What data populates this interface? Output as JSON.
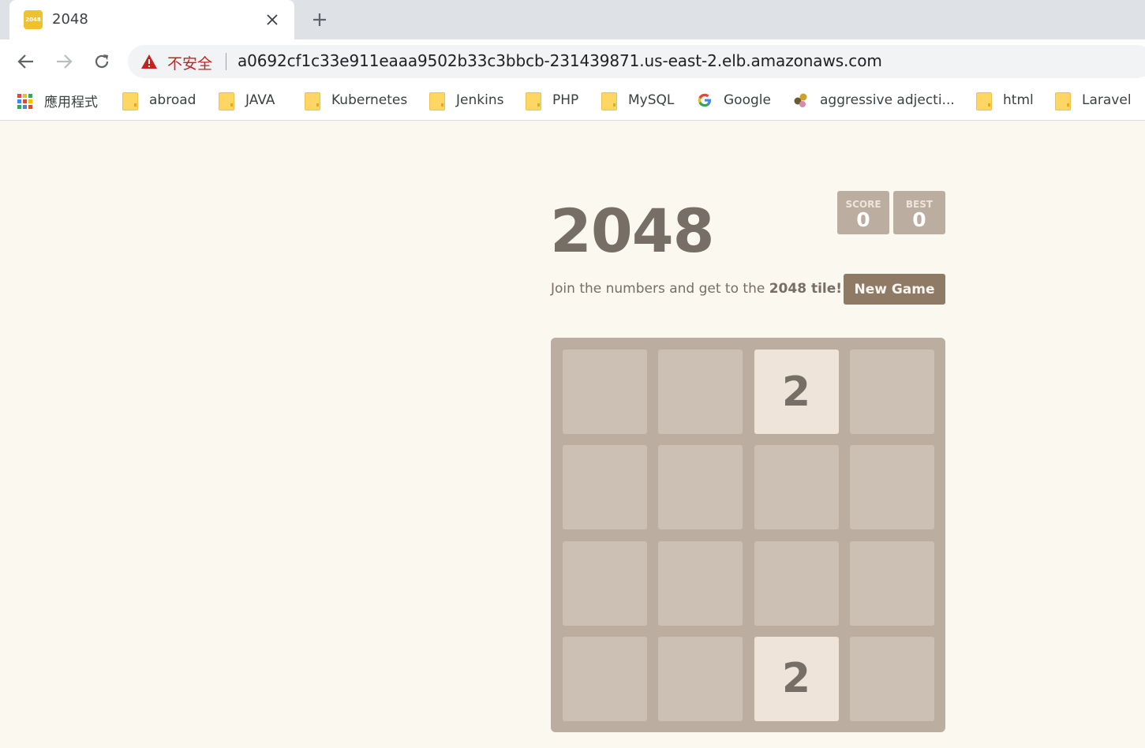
{
  "browser": {
    "tab": {
      "title": "2048",
      "favicon_text": "2048",
      "favicon_color": "#edc22e"
    },
    "new_tab_icon": "plus-icon",
    "close_icon": "close-icon",
    "nav": {
      "back_icon": "back-arrow-icon",
      "forward_icon": "forward-arrow-icon",
      "reload_icon": "reload-icon"
    },
    "omnibox": {
      "security_label": "不安全",
      "security_color": "#c5221f",
      "url": "a0692cf1c33e911eaaa9502b33c3bbcb-231439871.us-east-2.elb.amazonaws.com"
    },
    "bookmarks": [
      {
        "label": "應用程式",
        "icon": "apps-grid-icon"
      },
      {
        "label": "abroad",
        "icon": "folder-icon"
      },
      {
        "label": "JAVA",
        "icon": "folder-icon"
      },
      {
        "label": "Kubernetes",
        "icon": "folder-icon"
      },
      {
        "label": "Jenkins",
        "icon": "folder-icon"
      },
      {
        "label": "PHP",
        "icon": "folder-icon"
      },
      {
        "label": "MySQL",
        "icon": "folder-icon"
      },
      {
        "label": "Google",
        "icon": "google-g-icon"
      },
      {
        "label": "aggressive adjecti...",
        "icon": "site-favicon-icon"
      },
      {
        "label": "html",
        "icon": "folder-icon"
      },
      {
        "label": "Laravel",
        "icon": "folder-icon"
      }
    ]
  },
  "game": {
    "title": "2048",
    "score": {
      "label": "SCORE",
      "value": "0"
    },
    "best": {
      "label": "BEST",
      "value": "0"
    },
    "intro_prefix": "Join the numbers and get to the ",
    "intro_bold": "2048 tile!",
    "new_game_label": "New Game",
    "colors": {
      "background": "#faf8ef",
      "board": "#bbada0",
      "tile_2": "#eee4da",
      "text": "#776e65",
      "button": "#8f7a66"
    },
    "grid": [
      [
        null,
        null,
        "2",
        null
      ],
      [
        null,
        null,
        null,
        null
      ],
      [
        null,
        null,
        null,
        null
      ],
      [
        null,
        null,
        "2",
        null
      ]
    ]
  }
}
